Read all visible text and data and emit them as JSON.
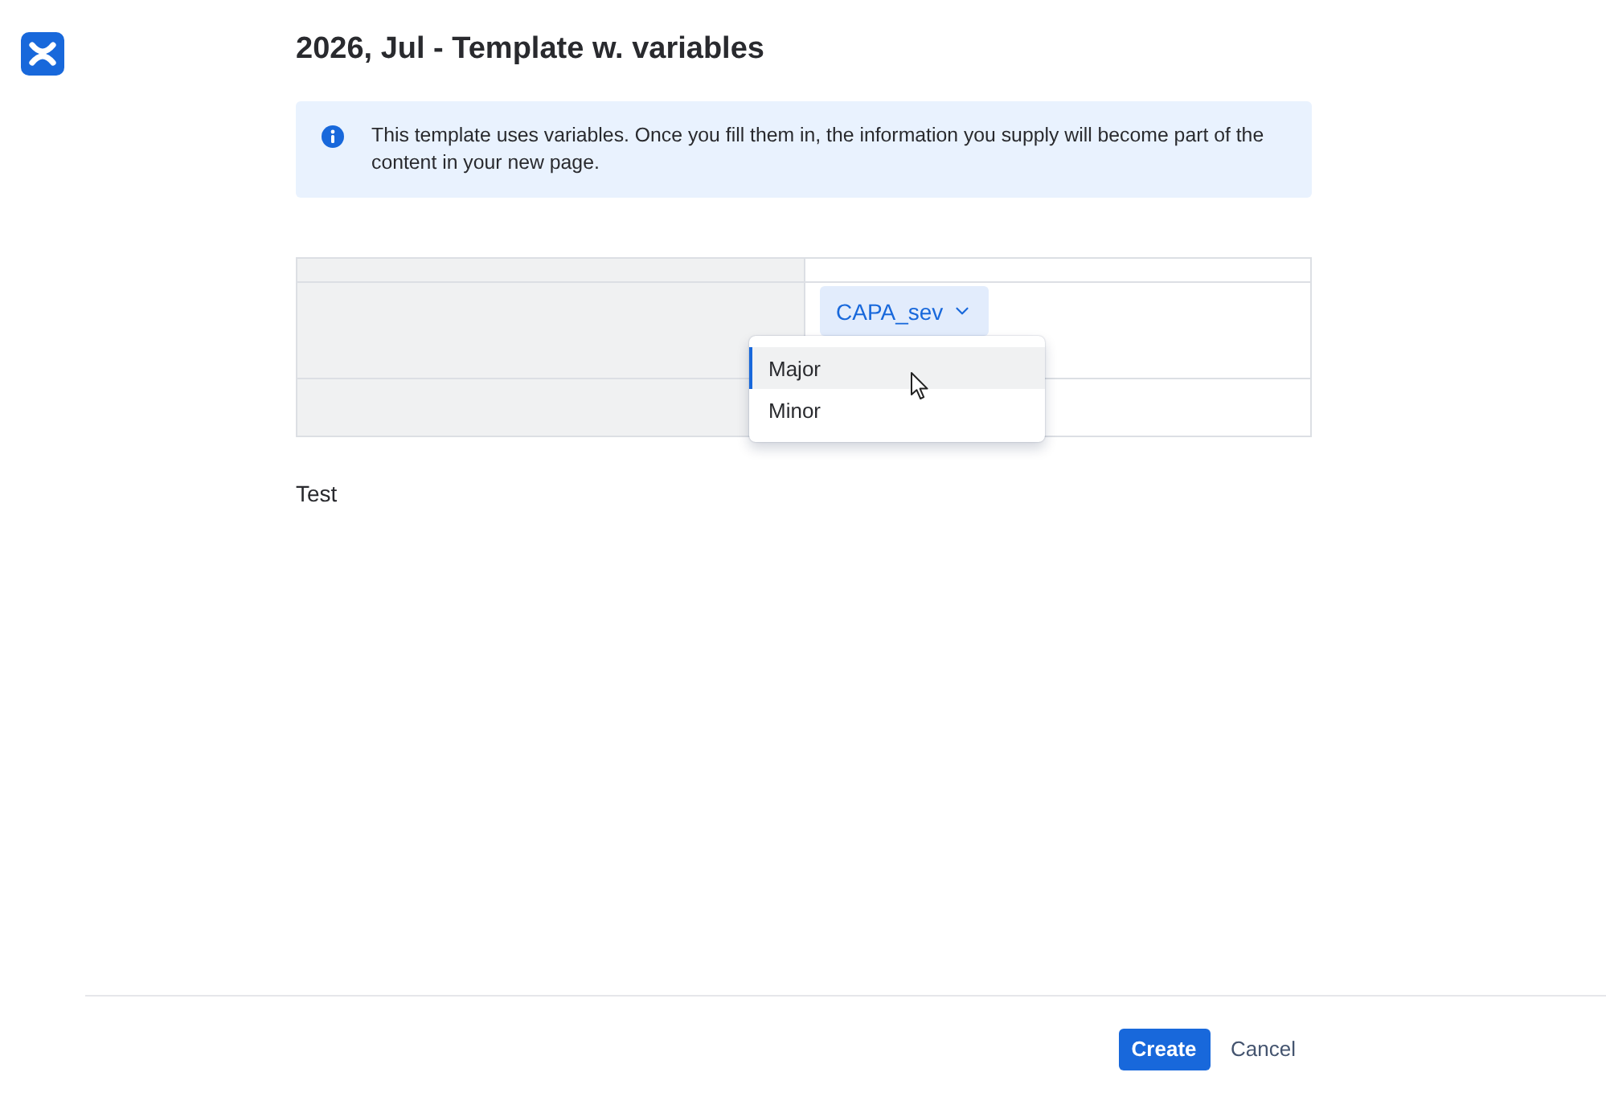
{
  "title": "2026, Jul - Template w. variables",
  "info_banner": {
    "text": "This template uses variables. Once you fill them in, the information you supply will become part of the content in your new page."
  },
  "table": {
    "rows": [
      {
        "kind": "header"
      },
      {
        "kind": "variable",
        "variable": {
          "name": "CAPA_sev",
          "expanded": true,
          "options": [
            {
              "label": "Major",
              "selected": true
            },
            {
              "label": "Minor",
              "selected": false
            }
          ]
        }
      },
      {
        "kind": "blank"
      }
    ]
  },
  "body_text": "Test",
  "buttons": [
    {
      "label": "Create",
      "kind": "primary"
    },
    {
      "label": "Cancel",
      "kind": "subtle"
    }
  ]
}
